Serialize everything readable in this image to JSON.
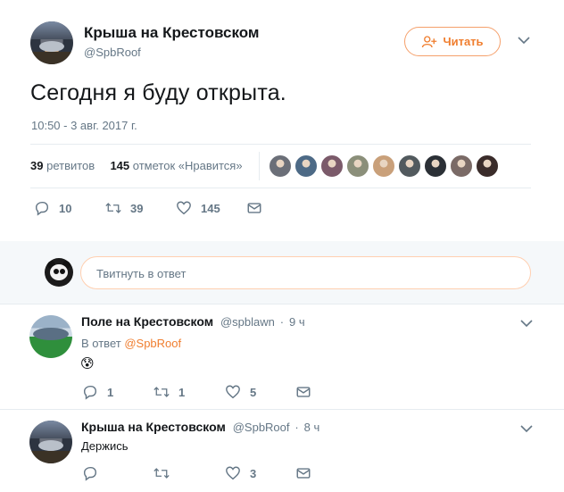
{
  "main_tweet": {
    "author_name": "Крыша на Крестовском",
    "handle": "@SpbRoof",
    "follow_label": "Читать",
    "text": "Сегодня я буду открыта.",
    "timestamp": "10:50 - 3 авг. 2017 г.",
    "stats": {
      "retweets_count": "39",
      "retweets_label": "ретвитов",
      "likes_count": "145",
      "likes_label": "отметок «Нравится»"
    },
    "liker_colors": [
      "#6b6f78",
      "#4d6a86",
      "#7b5a6a",
      "#8b8f7a",
      "#c9a07a",
      "#525a5e",
      "#2b3036",
      "#7a6a66",
      "#3a2c2a"
    ],
    "actions": {
      "replies": "10",
      "retweets": "39",
      "likes": "145"
    }
  },
  "reply_box": {
    "placeholder": "Твитнуть в ответ"
  },
  "replies": [
    {
      "author_name": "Поле на Крестовском",
      "handle": "@spblawn",
      "time": "9 ч",
      "reply_to_prefix": "В ответ",
      "reply_to_mention": "@SpbRoof",
      "text": "😰",
      "actions": {
        "replies": "1",
        "retweets": "1",
        "likes": "5"
      }
    },
    {
      "author_name": "Крыша на Крестовском",
      "handle": "@SpbRoof",
      "time": "8 ч",
      "text": "Держись",
      "actions": {
        "replies": "",
        "retweets": "",
        "likes": "3"
      }
    }
  ],
  "colors": {
    "accent": "#f07e2f",
    "secondary_text": "#657786",
    "divider": "#e6ecf0"
  }
}
